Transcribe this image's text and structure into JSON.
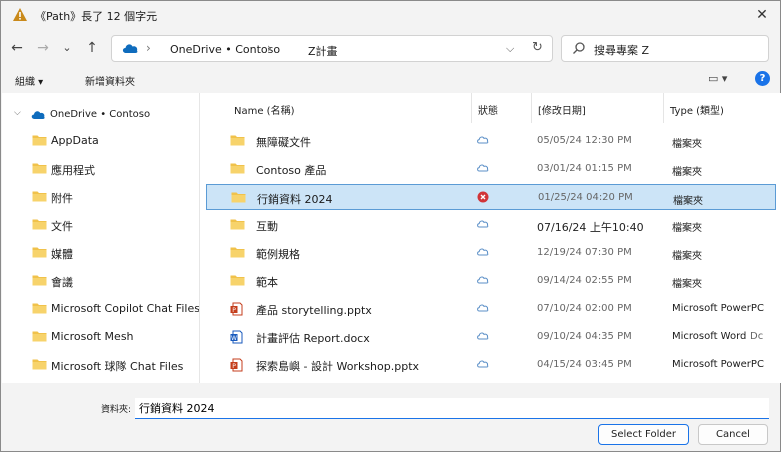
{
  "titlebar": {
    "title": "《Path》長了 12 個字元",
    "close_glyph": "✕"
  },
  "nav": {
    "back": "←",
    "forward": "→",
    "recent": "⌄",
    "up": "↑"
  },
  "address": {
    "sep": "›",
    "crumbs": [
      "OneDrive • Contoso",
      "Z計畫"
    ],
    "chevron": "⌵",
    "refresh": "↻"
  },
  "search": {
    "text": "搜尋專案 Z"
  },
  "commands": {
    "organize": "組織 ▾",
    "new_folder": "新增資料夾",
    "view": "▭ ▾",
    "help": "?"
  },
  "sidebar": {
    "root": {
      "expander": "⌵",
      "label": "OneDrive • Contoso"
    },
    "items": [
      {
        "label": "AppData"
      },
      {
        "label": "應用程式"
      },
      {
        "label": "附件"
      },
      {
        "label": "文件"
      },
      {
        "label": "媒體"
      },
      {
        "label": "會議"
      },
      {
        "label": "Microsoft Copilot Chat Files"
      },
      {
        "label": "Microsoft Mesh"
      },
      {
        "label": "Microsoft 球隊 Chat Files"
      }
    ]
  },
  "columns": {
    "name": "Name (名稱)",
    "status": "狀態",
    "date": "[修改日期]",
    "type": "Type (類型)"
  },
  "rows": [
    {
      "name": "無障礙文件",
      "status": "cloud",
      "date": "05/05/24 12:30 PM",
      "type": "檔案夾",
      "icon": "folder-icon"
    },
    {
      "name": "Contoso 產品",
      "status": "cloud",
      "date": "03/01/24 01:15 PM",
      "type": "檔案夾",
      "icon": "folder-icon"
    },
    {
      "name": "行銷資料 2024",
      "status": "error",
      "date": "01/25/24 04:20 PM",
      "type": "檔案夾",
      "icon": "folder-icon"
    },
    {
      "name": "互動",
      "status": "cloud",
      "date": "07/16/24 上午10:40",
      "type": "檔案夾",
      "icon": "folder-icon"
    },
    {
      "name": "範例規格",
      "status": "cloud",
      "date": "12/19/24 07:30 PM",
      "type": "檔案夾",
      "icon": "folder-icon"
    },
    {
      "name": "範本",
      "status": "cloud",
      "date": "09/14/24 02:55 PM",
      "type": "檔案夾",
      "icon": "folder-icon"
    },
    {
      "name": "產品 storytelling.pptx",
      "status": "cloud",
      "date": "07/10/24 02:00 PM",
      "type": "Microsoft PowerPC",
      "type_extra": "",
      "icon": "pptx-icon"
    },
    {
      "name": "計畫評估 Report.docx",
      "status": "cloud",
      "date": "09/10/24 04:35 PM",
      "type": "Microsoft Word",
      "type_extra": "Dc",
      "icon": "docx-icon"
    },
    {
      "name": "探索島嶼 - 設計 Workshop.pptx",
      "status": "cloud",
      "date": "04/15/24 03:45 PM",
      "type": "Microsoft PowerPC",
      "type_extra": "",
      "icon": "pptx-icon"
    }
  ],
  "footer": {
    "filename_label": "資料夾:",
    "filename_value": "行銷資料 2024",
    "select_label": "Select Folder",
    "cancel_label": "Cancel"
  },
  "colors": {
    "accent": "#1a73e8",
    "folder": "#f0c24b",
    "selected_row": "#cce4f7",
    "error": "#d13438"
  }
}
